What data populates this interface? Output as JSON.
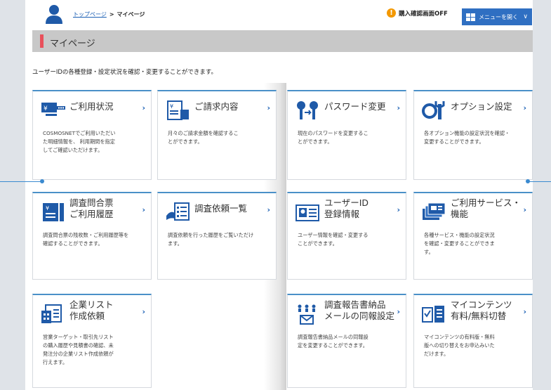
{
  "header": {
    "breadcrumb_home": "トップページ",
    "breadcrumb_sep": ">",
    "breadcrumb_current": "マイページ",
    "purchase_confirm": "購入確認画面OFF",
    "menu_button": "メニューを開く"
  },
  "page_title": "マイページ",
  "description": "ユーザーIDの各種登録・設定状況を確認・変更することができます。",
  "tiles": [
    {
      "title": "ご利用状況",
      "body": "COSMOSNETでご利用いただい\nた明細情報を、 利用期間を指定\nしてご確認いただけます。",
      "icon": "yen-bill-icon"
    },
    {
      "title": "ご請求内容",
      "body": "月々のご請求金額を確認するこ\nとができます。",
      "icon": "invoice-icon"
    },
    {
      "title": "パスワード変更",
      "body": "現在のパスワードを変更するこ\nとができます。",
      "icon": "key-icon"
    },
    {
      "title": "オプション設定",
      "body": "各オプション機能の設定状況を確認・\n変更することができます。",
      "icon": "gear-icon"
    },
    {
      "title": "調査問合票\nご利用履歴",
      "body": "調査問合票の残枚数・ご利用履歴等を\n確認することができます。",
      "icon": "inquiry-ticket-icon"
    },
    {
      "title": "調査依頼一覧",
      "body": "調査依頼を行った履歴をご覧いただけ\nます。",
      "icon": "request-list-icon"
    },
    {
      "title": "ユーザーID\n登録情報",
      "body": "ユーザー情報を確認・変更する\nことができます。",
      "icon": "id-card-icon"
    },
    {
      "title": "ご利用サービス・\n機能",
      "body": "各種サービス・機能の設定状況\nを確認・変更することができま\nす。",
      "icon": "services-icon"
    },
    {
      "title": "企業リスト\n作成依頼",
      "body": "営業ターゲット・取引先リスト\nの購入履歴や見積書の確認、未\n発注分の企業リスト作成依頼が\n行えます。",
      "icon": "company-list-icon"
    },
    {
      "title": "調査報告書納品\nメールの同報設定",
      "body": "調査報告書納品メールの同報設\n定を変更することができます。",
      "icon": "mail-broadcast-icon"
    },
    {
      "title": "マイコンテンツ\n有料/無料切替",
      "body": "マイコンテンツの有料版・無料\n版への切り替えをお申込みいた\nだけます。",
      "icon": "my-contents-icon"
    }
  ],
  "colors": {
    "accent": "#2f6fc2",
    "title_marker": "#e8505b",
    "tile_border": "#4a90c8"
  }
}
